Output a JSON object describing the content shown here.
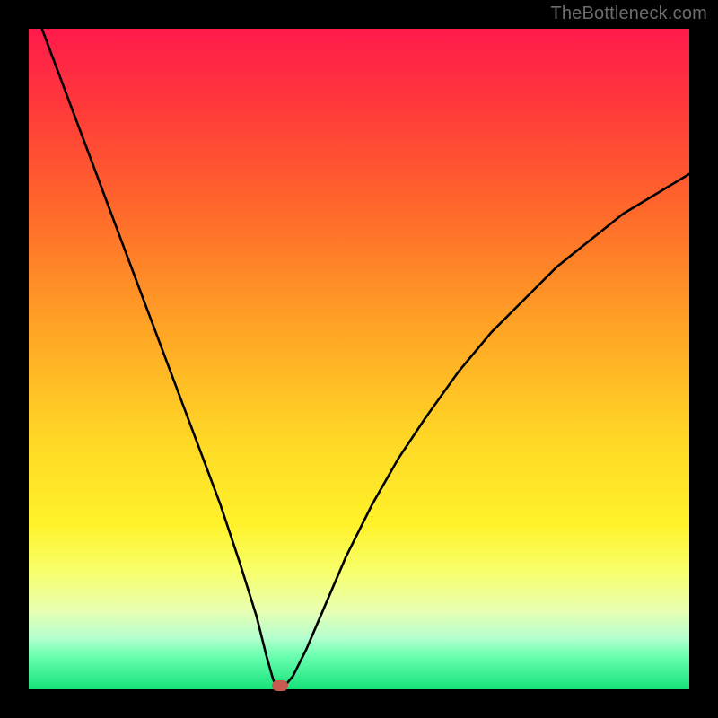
{
  "watermark": "TheBottleneck.com",
  "chart_data": {
    "type": "line",
    "title": "",
    "xlabel": "",
    "ylabel": "",
    "xlim": [
      0,
      100
    ],
    "ylim": [
      0,
      100
    ],
    "grid": false,
    "legend": false,
    "minimum_marker": {
      "x": 38,
      "y": 0
    },
    "series": [
      {
        "name": "bottleneck-curve-left",
        "x": [
          2,
          5,
          8,
          11,
          14,
          17,
          20,
          23,
          26,
          29,
          32,
          34.5,
          36,
          37,
          37.6
        ],
        "y": [
          100,
          92,
          84,
          76,
          68,
          60,
          52,
          44,
          36,
          28,
          19,
          11,
          5,
          1.5,
          0.2
        ]
      },
      {
        "name": "bottleneck-curve-right",
        "x": [
          38.5,
          40,
          42,
          45,
          48,
          52,
          56,
          60,
          65,
          70,
          75,
          80,
          85,
          90,
          95,
          100
        ],
        "y": [
          0.2,
          2,
          6,
          13,
          20,
          28,
          35,
          41,
          48,
          54,
          59,
          64,
          68,
          72,
          75,
          78
        ]
      }
    ],
    "colors": {
      "curve": "#000000",
      "marker": "#c75b4f",
      "frame": "#000000"
    }
  }
}
